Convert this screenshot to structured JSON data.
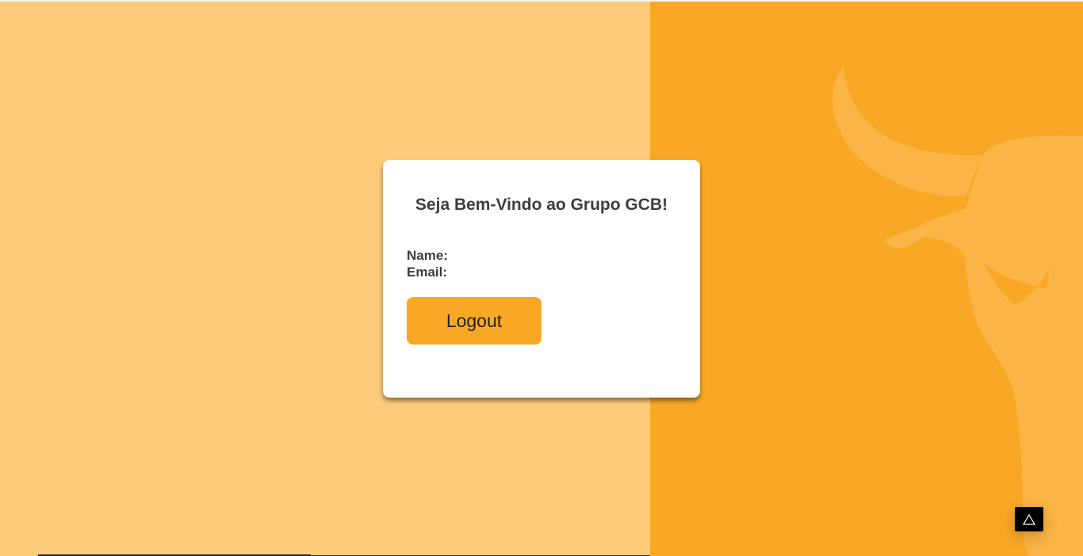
{
  "colors": {
    "background_light": "#fecb7a",
    "background_accent": "#f9a826",
    "card": "#ffffff",
    "text": "#3d3d3d",
    "button": "#f9a826"
  },
  "card": {
    "title": "Seja Bem-Vindo ao Grupo GCB!",
    "name_label": "Name:",
    "email_label": "Email:",
    "logout_label": "Logout"
  },
  "decor": {
    "bull_icon": "bull-silhouette-icon",
    "scroll_top_icon": "triangle-up-icon"
  }
}
